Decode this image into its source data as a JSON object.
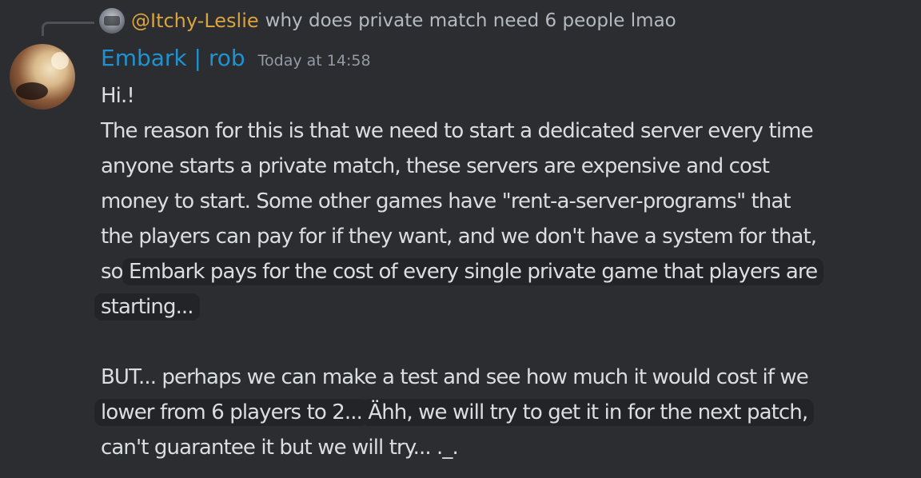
{
  "reply": {
    "mention": "@Itchy-Leslie",
    "text": "why does private match need 6 people lmao"
  },
  "message": {
    "author": "Embark | rob",
    "timestamp": "Today at 14:58",
    "lines": {
      "l1": "Hi.!",
      "l2": "The reason for this is that we need to start a dedicated server every time",
      "l3": "anyone starts a private match, these servers are expensive and cost",
      "l4": "money to start. Some other games have \"rent-a-server-programs\" that",
      "l5": "the players can pay for if they want, and we don't have a system for that,",
      "l6a": "so ",
      "l6b": "Embark pays for the cost of every single private game that players are",
      "l7": "starting...",
      "l8": "BUT... perhaps we can make a test and see how much it would cost if we",
      "l9a": "lower from 6 players to 2...",
      "l9b": " ",
      "l9c": "Ähh, we will try to get it in for the next patch,",
      "l10": "can't guarantee it but we will try... ._."
    }
  },
  "colors": {
    "background": "#2b2d31",
    "author": "#1f93d1",
    "mention": "#d9a33f",
    "text": "#dbdee1",
    "muted": "#949ba4",
    "highlight": "#232428"
  }
}
